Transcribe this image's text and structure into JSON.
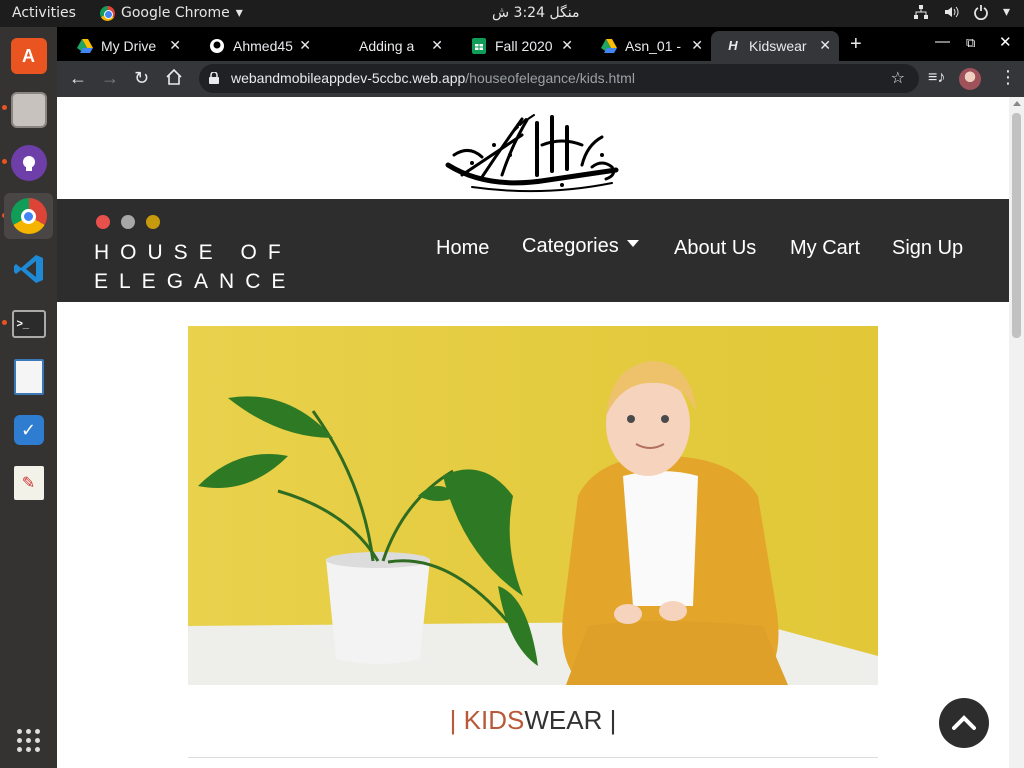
{
  "system_bar": {
    "activities": "Activities",
    "app_name": "Google Chrome",
    "clock": "منگل 3:24 ش"
  },
  "dock": {
    "items": [
      "ubuntu-software",
      "files",
      "github-desktop",
      "google-chrome",
      "vscode",
      "terminal",
      "image-viewer",
      "tasks",
      "text-editor",
      "show-applications"
    ]
  },
  "browser": {
    "tabs": [
      {
        "label": "My Drive",
        "icon": "google-drive-icon"
      },
      {
        "label": "Ahmed45",
        "icon": "github-icon"
      },
      {
        "label": "Adding a",
        "icon": "blank-icon"
      },
      {
        "label": "Fall 2020",
        "icon": "google-sheets-icon"
      },
      {
        "label": "Asn_01 - ",
        "icon": "google-drive-icon"
      },
      {
        "label": "Kidswear",
        "icon": "site-h-icon"
      }
    ],
    "active_tab": 5,
    "url_host": "webandmobileappdev-5ccbc.web.app",
    "url_path": "/houseofelegance/kids.html"
  },
  "site": {
    "brand_line1": "HOUSE OF",
    "brand_line2": "ELEGANCE",
    "brand_dot_colors": [
      "#e8514b",
      "#a7a7a7",
      "#c69a0c"
    ],
    "nav": {
      "home": "Home",
      "categories": "Categories",
      "about": "About Us",
      "cart": "My Cart",
      "signup": "Sign Up"
    },
    "section": {
      "bar_left": "|",
      "kids": "KIDS",
      "wear": "WEAR",
      "bar_right": "|"
    },
    "accent_color": "#b85a3a",
    "nav_bg": "#2d2d2d"
  }
}
